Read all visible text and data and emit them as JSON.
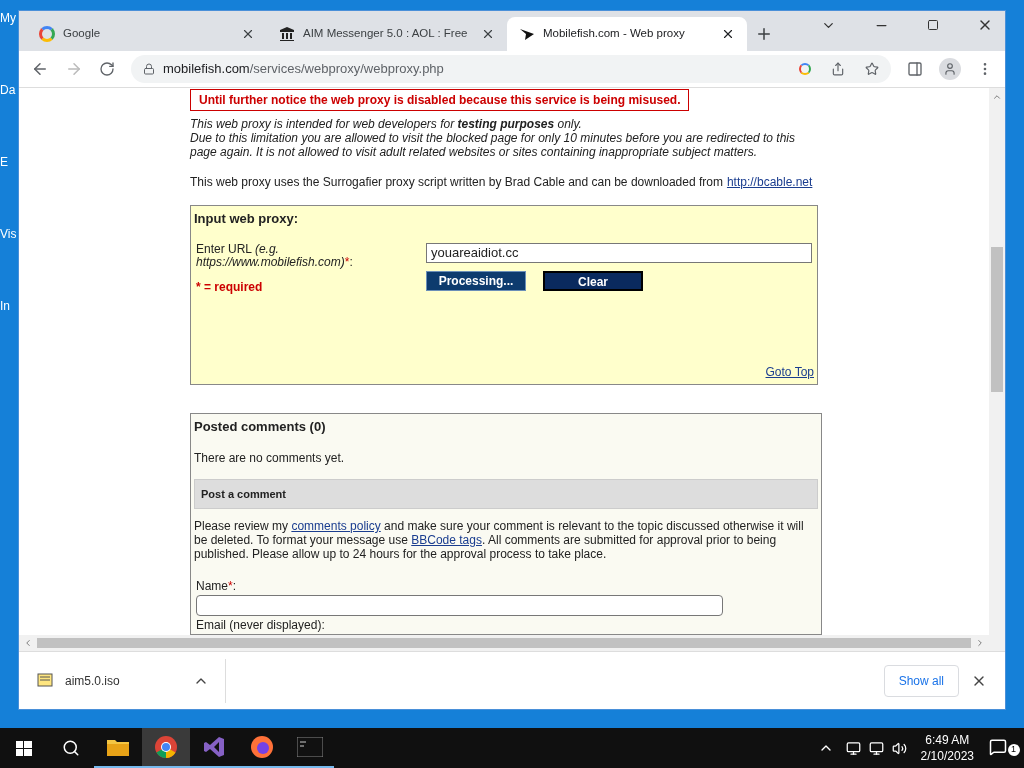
{
  "desktop_icons": [
    "My",
    "Da",
    "E",
    "Vis",
    "In"
  ],
  "tabs": [
    {
      "title": "Google",
      "selected": false
    },
    {
      "title": "AIM Messenger 5.0 : AOL : Free",
      "selected": false
    },
    {
      "title": "Mobilefish.com - Web proxy",
      "selected": true
    }
  ],
  "address_bar": {
    "domain": "mobilefish.com",
    "path": "/services/webproxy/webproxy.php"
  },
  "page": {
    "notice": "Until further notice the web proxy is disabled because this service is being misused.",
    "intro": "This web proxy is intended for web developers for **testing purposes** only.",
    "limitation": "Due to this limitation you are allowed to visit the blocked page for only 10 minutes before you are redirected to this page again. It is not allowed to visit adult related websites or sites containing inappropriate subject matters.",
    "credit": "This web proxy uses the Surrogafier proxy script written by Brad Cable and can be downloaded from",
    "credit_link": "http://bcable.net",
    "proxy_form": {
      "title": "Input web proxy:",
      "url_label": "Enter URL",
      "url_example": "(e.g. https://www.mobilefish.com)",
      "required_mark": "*",
      "label_colon": ":",
      "url_value": "youareaidiot.cc",
      "required_note": "* = required",
      "buttons": [
        {
          "label": "Processing...",
          "disabled": true
        },
        {
          "label": "Clear",
          "disabled": false
        }
      ],
      "goto_top": "Goto Top"
    },
    "comments": {
      "title": "Posted comments (0)",
      "empty": "There are no comments yet.",
      "post_title": "Post a comment",
      "policy": [
        "Please review my ",
        {
          "link": "comments policy"
        },
        " and make sure your comment is relevant to the topic discussed otherwise it will be deleted. To format your message use ",
        {
          "link": "BBCode tags"
        },
        ". All comments are submitted for approval prior to being published. Please allow up to 24 hours for the approval process to take place."
      ],
      "name_label": "Name",
      "required_mark": "*",
      "label_colon": ":",
      "email_label": "Email (never displayed):"
    }
  },
  "download_bar": {
    "file": "aim5.0.iso",
    "show_all": "Show all"
  },
  "taskbar": {
    "apps": [
      {
        "kind": "folder",
        "selected": false
      },
      {
        "kind": "browser",
        "selected": true
      },
      {
        "kind": "ide",
        "selected": false
      },
      {
        "kind": "firefox",
        "selected": false
      },
      {
        "kind": "terminal",
        "selected": false
      }
    ],
    "time": "6:49 AM",
    "date": "2/10/2023",
    "notifications": "1"
  }
}
